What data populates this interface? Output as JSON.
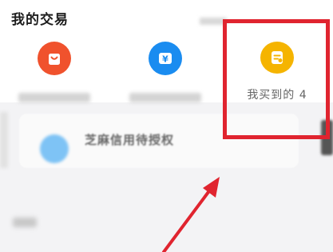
{
  "section": {
    "title": "我的交易"
  },
  "entries": [
    {
      "icon": "shopping-bag-icon",
      "label": "",
      "color": "#f0522d"
    },
    {
      "icon": "yuan-wallet-icon",
      "label": "",
      "color": "#1a8cf0"
    },
    {
      "icon": "receipt-icon",
      "label": "我买到的 4",
      "color": "#f5b400"
    }
  ],
  "credit_card": {
    "title": "芝麻信用待授权",
    "icon": "zhima-credit-icon"
  },
  "annotation": {
    "highlight_color": "#e0242f"
  }
}
